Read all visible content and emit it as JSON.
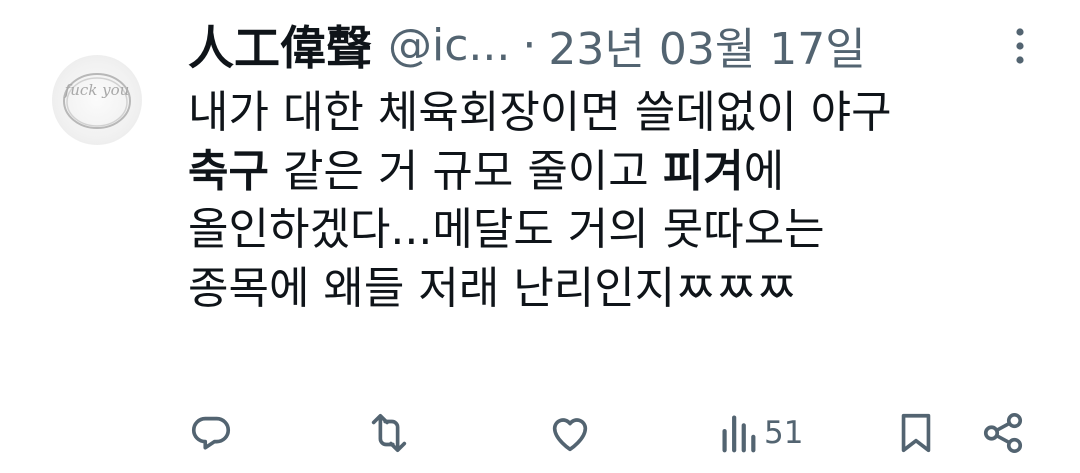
{
  "tweet": {
    "author_name": "人工偉聲",
    "handle": "@ic...",
    "separator": "·",
    "date": "23년 03월 17일",
    "avatar_text": "fuck you",
    "lines": [
      [
        {
          "text": "내가 대한 체육회장이면 쓸데없이 야구",
          "bold": false
        }
      ],
      [
        {
          "text": "축구",
          "bold": true
        },
        {
          "text": " 같은 거 규모 줄이고 ",
          "bold": false
        },
        {
          "text": "피겨",
          "bold": true
        },
        {
          "text": "에",
          "bold": false
        }
      ],
      [
        {
          "text": "올인하겠다...메달도 거의 못따오는",
          "bold": false
        }
      ],
      [
        {
          "text": "종목에  왜들 저래 난리인지ㅉㅉㅉ",
          "bold": false
        }
      ]
    ]
  },
  "actions": {
    "reply_icon": "reply-icon",
    "retweet_icon": "retweet-icon",
    "like_icon": "heart-icon",
    "views_icon": "views-chart-icon",
    "views_count": "51",
    "bookmark_icon": "bookmark-icon",
    "share_icon": "share-icon"
  },
  "colors": {
    "text": "#0f1419",
    "muted": "#536471",
    "background": "#ffffff"
  }
}
